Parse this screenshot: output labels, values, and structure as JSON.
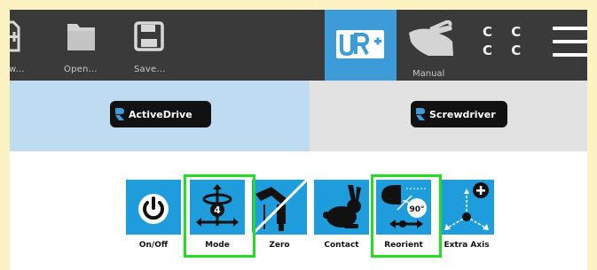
{
  "toolbar": {
    "new_label": "w...",
    "open_label": "Open...",
    "save_label": "Save...",
    "urplus_text": "UR+",
    "manual_label": "Manual",
    "mode_letters": "C C C C"
  },
  "tabs": [
    {
      "label": "ActiveDrive",
      "selected": true
    },
    {
      "label": "Screwdriver",
      "selected": false
    }
  ],
  "functions": [
    {
      "label": "On/Off",
      "icon": "power-icon",
      "highlighted": false
    },
    {
      "label": "Mode",
      "icon": "mode-axes-icon",
      "badge": "4",
      "highlighted": true
    },
    {
      "label": "Zero",
      "icon": "zero-force-icon",
      "highlighted": false
    },
    {
      "label": "Contact",
      "icon": "rabbit-icon",
      "highlighted": false
    },
    {
      "label": "Reorient",
      "icon": "reorient-icon",
      "badge": "90°",
      "highlighted": true
    },
    {
      "label": "Extra Axis",
      "icon": "extra-axis-icon",
      "highlighted": false
    }
  ],
  "colors": {
    "toolbar": "#3A3A3A",
    "accent_blue": "#3D9BD8",
    "tab_selected": "#BFDBF1",
    "tab_unselected": "#E2E2E2",
    "icon_blue": "#1E9CDC",
    "highlight": "#22DD22",
    "outer_frame": "#FCF2C2"
  }
}
